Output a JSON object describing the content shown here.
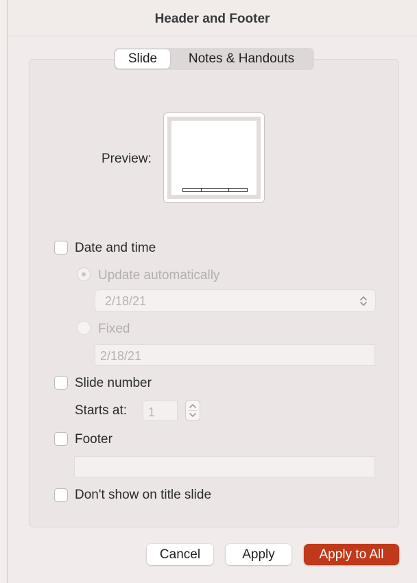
{
  "dialog": {
    "title": "Header and Footer"
  },
  "tabs": [
    {
      "label": "Slide",
      "selected": true
    },
    {
      "label": "Notes & Handouts",
      "selected": false
    }
  ],
  "preview": {
    "label": "Preview:"
  },
  "date_time": {
    "label": "Date and time",
    "checked": false,
    "update_automatically": {
      "label": "Update automatically",
      "selected": true,
      "enabled": false
    },
    "date_format_popup": {
      "value": "2/18/21",
      "enabled": false,
      "icon": "chevron-updown-icon"
    },
    "fixed": {
      "label": "Fixed",
      "selected": false,
      "enabled": false
    },
    "fixed_field": {
      "value": "2/18/21",
      "enabled": false
    }
  },
  "slide_number": {
    "label": "Slide number",
    "checked": false,
    "starts_at_label": "Starts at:",
    "starts_at_value": "1",
    "stepper_icon": "stepper-arrows-icon"
  },
  "footer": {
    "label": "Footer",
    "checked": false,
    "value": ""
  },
  "dont_show_on_title": {
    "label": "Don't show on title slide",
    "checked": false
  },
  "buttons": {
    "cancel": "Cancel",
    "apply": "Apply",
    "apply_all": "Apply to All"
  },
  "colors": {
    "accent": "#c0391b",
    "disabled_text": "#b3afae"
  }
}
